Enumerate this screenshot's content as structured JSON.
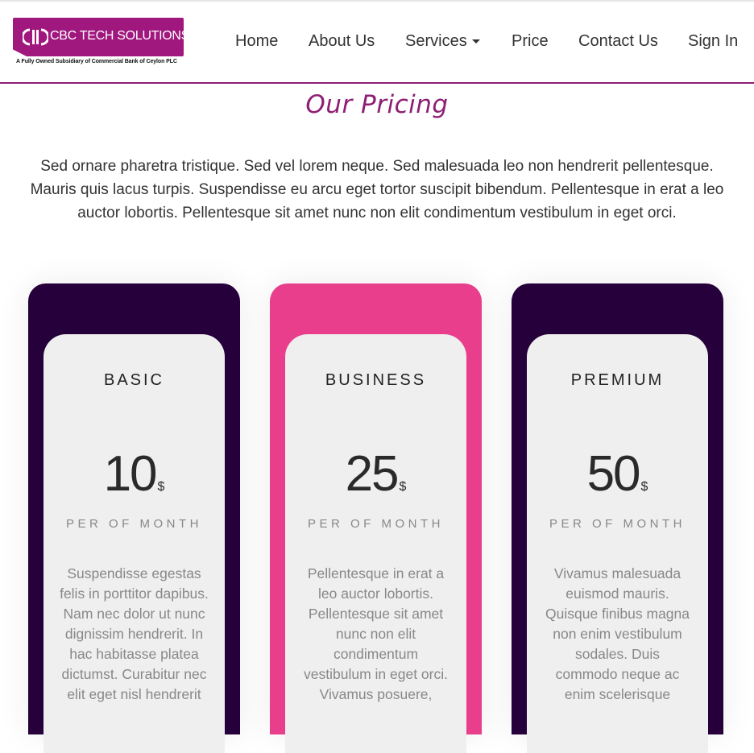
{
  "brand": {
    "name": "CBC TECH SOLUTIONS",
    "tagline": "A Fully Owned Subsidiary of Commercial Bank of Ceylon PLC",
    "color": "#a0177e"
  },
  "nav": {
    "items": [
      {
        "label": "Home"
      },
      {
        "label": "About Us"
      },
      {
        "label": "Services"
      },
      {
        "label": "Price"
      },
      {
        "label": "Contact Us"
      },
      {
        "label": "Sign In"
      }
    ]
  },
  "pricing": {
    "title": "Our Pricing",
    "intro": "Sed ornare pharetra tristique. Sed vel lorem neque. Sed malesuada leo non hendrerit pellentesque. Mauris quis lacus turpis. Suspendisse eu arcu eget tortor suscipit bibendum. Pellentesque in erat a leo auctor lobortis. Pellentesque sit amet nunc non elit condimentum vestibulum in eget orci.",
    "plans": [
      {
        "name": "BASIC",
        "price": "10",
        "currency": "$",
        "period": "PER OF MONTH",
        "description": "Suspendisse egestas felis in porttitor dapibus. Nam nec dolor ut nunc dignissim hendrerit. In hac habitasse platea dictumst. Curabitur nec elit eget nisl hendrerit",
        "accent": "#26003a"
      },
      {
        "name": "BUSINESS",
        "price": "25",
        "currency": "$",
        "period": "PER OF MONTH",
        "description": "Pellentesque in erat a leo auctor lobortis. Pellentesque sit amet nunc non elit condimentum vestibulum in eget orci. Vivamus posuere,",
        "accent": "#e83e8c"
      },
      {
        "name": "PREMIUM",
        "price": "50",
        "currency": "$",
        "period": "PER OF MONTH",
        "description": "Vivamus malesuada euismod mauris. Quisque finibus magna non enim vestibulum sodales. Duis commodo neque ac enim scelerisque",
        "accent": "#26003a"
      }
    ]
  },
  "colors": {
    "heading": "#8e1f74",
    "dark": "#26003a",
    "pink": "#e83e8c"
  }
}
